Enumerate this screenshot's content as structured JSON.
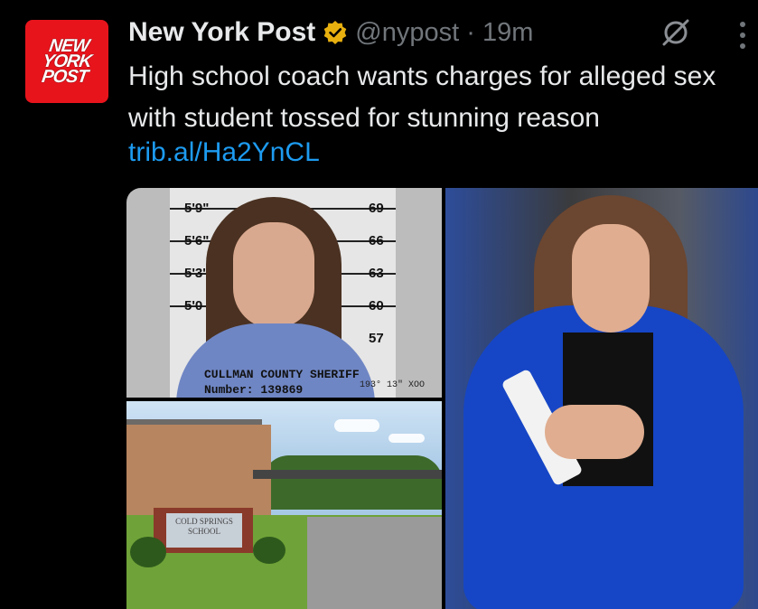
{
  "account": {
    "avatar_text_line1": "NEW",
    "avatar_text_line2": "YORK",
    "avatar_text_line3": "POST",
    "display_name": "New York Post",
    "handle_time": "@nypost · 19m"
  },
  "tweet": {
    "text": "High school coach wants charges for alleged sex with student tossed for stunning reason",
    "link": "trib.al/Ha2YnCL"
  },
  "media": {
    "mugshot": {
      "height_labels": [
        "5'9\"",
        "5'6\"",
        "5'3'",
        "5'0",
        "69",
        "66",
        "63",
        "60",
        "57"
      ],
      "caption_line1": "CULLMAN COUNTY SHERIFF",
      "caption_line2": "Number: 139869",
      "small_text": "193° 13\" XOO"
    },
    "school": {
      "sign_text_line1": "COLD SPRINGS",
      "sign_text_line2": "SCHOOL"
    }
  },
  "icons": {
    "verified": "verified-badge-icon",
    "grok": "grok-icon",
    "more": "more-options-icon"
  },
  "colors": {
    "link": "#1d9bf0",
    "brand_red": "#e8141c",
    "verified_gold": "#e8b00f"
  }
}
